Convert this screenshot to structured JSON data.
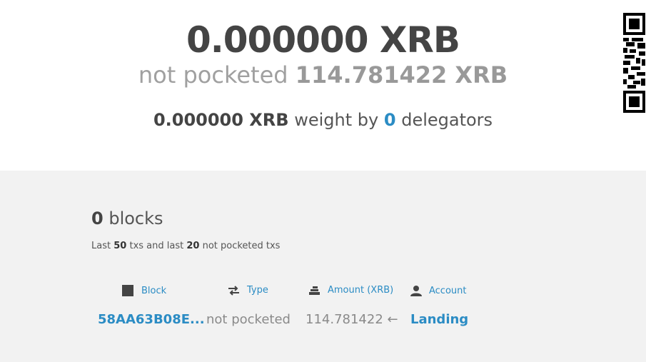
{
  "summary": {
    "balance": "0.000000 XRB",
    "pending_prefix": "not pocketed",
    "pending_amount": "114.781422 XRB",
    "weight_amount": "0.000000 XRB",
    "weight_text": "weight by",
    "delegators_count": "0",
    "delegators_text": "delegators"
  },
  "qr_icon": "qr-code",
  "blocks": {
    "count": "0",
    "label": "blocks",
    "sub_last": "Last",
    "sub_txs_count": "50",
    "sub_txs_and": "txs and last",
    "sub_pending_count": "20",
    "sub_pending_label": "not pocketed txs"
  },
  "table": {
    "headers": [
      {
        "label": "Block",
        "icon": "square-icon"
      },
      {
        "label": "Type",
        "icon": "exchange-icon"
      },
      {
        "label": "Amount (XRB)",
        "icon": "coins-icon"
      },
      {
        "label": "Account",
        "icon": "user-icon"
      }
    ],
    "rows": [
      {
        "block": "58AA63B08E...",
        "type": "not pocketed",
        "amount": "114.781422",
        "direction": "←",
        "account": "Landing"
      }
    ]
  },
  "colors": {
    "link": "#2b8cc4",
    "text_dark": "#444444",
    "text_muted": "#a0a0a0",
    "panel_bg": "#f2f2f2"
  }
}
